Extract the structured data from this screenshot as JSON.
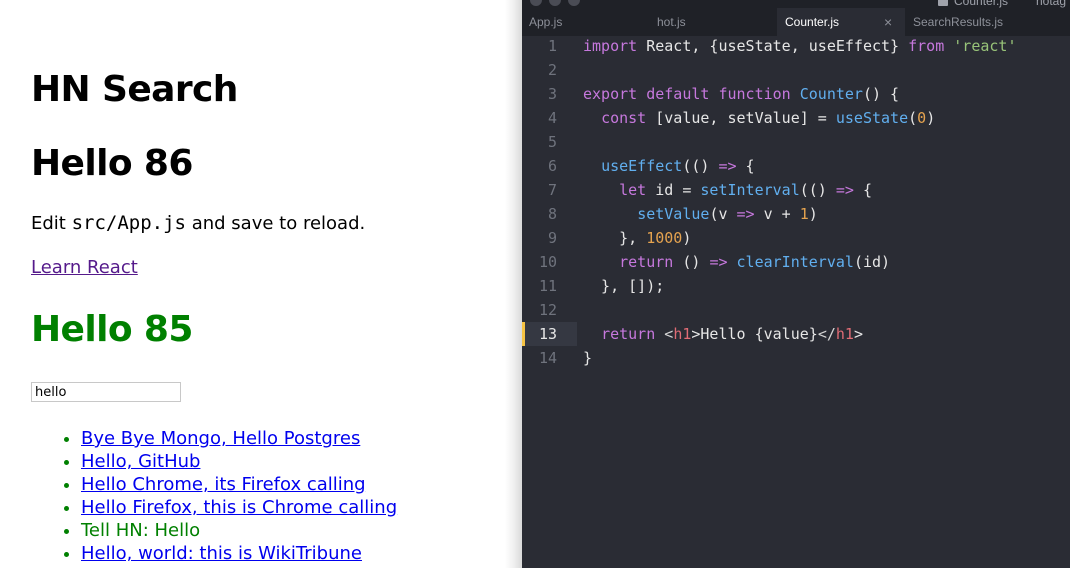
{
  "preview": {
    "title": "HN Search",
    "hello_first": "Hello 86",
    "edit_prefix": "Edit ",
    "edit_code": "src/App.js",
    "edit_suffix": " and save to reload.",
    "learn_link": "Learn React",
    "hello_second": "Hello 85",
    "search_value": "hello",
    "results": [
      {
        "text": "Bye Bye Mongo, Hello Postgres",
        "link": true
      },
      {
        "text": "Hello, GitHub",
        "link": true
      },
      {
        "text": "Hello Chrome, its Firefox calling",
        "link": true
      },
      {
        "text": "Hello Firefox, this is Chrome calling",
        "link": true
      },
      {
        "text": "Tell HN: Hello",
        "link": false
      },
      {
        "text": "Hello, world: this is WikiTribune",
        "link": true
      }
    ],
    "colors": {
      "green": "#008000",
      "link": "#0000ee",
      "visited": "#551a8b"
    }
  },
  "editor": {
    "top_title": "Counter.js",
    "top_title_right": "hotag",
    "tabs": [
      {
        "label": "App.js",
        "active": false
      },
      {
        "label": "hot.js",
        "active": false
      },
      {
        "label": "Counter.js",
        "active": true
      },
      {
        "label": "SearchResults.js",
        "active": false
      }
    ],
    "close_glyph": "×",
    "current_line": 13,
    "line_numbers": [
      "1",
      "2",
      "3",
      "4",
      "5",
      "6",
      "7",
      "8",
      "9",
      "10",
      "11",
      "12",
      "13",
      "14"
    ],
    "code_lines": [
      "import React, {useState, useEffect} from 'react'",
      "",
      "export default function Counter() {",
      "  const [value, setValue] = useState(0)",
      "",
      "  useEffect(() => {",
      "    let id = setInterval(() => {",
      "      setValue(v => v + 1)",
      "    }, 1000)",
      "    return () => clearInterval(id)",
      "  }, []);",
      "",
      "  return <h1>Hello {value}</h1>",
      "}"
    ],
    "colors": {
      "background": "#2a2c34",
      "keyword": "#c678dd",
      "function": "#61afef",
      "string": "#98c379",
      "number": "#e5a34f",
      "tag": "#e06c75",
      "current_line_marker": "#f6c343"
    }
  }
}
